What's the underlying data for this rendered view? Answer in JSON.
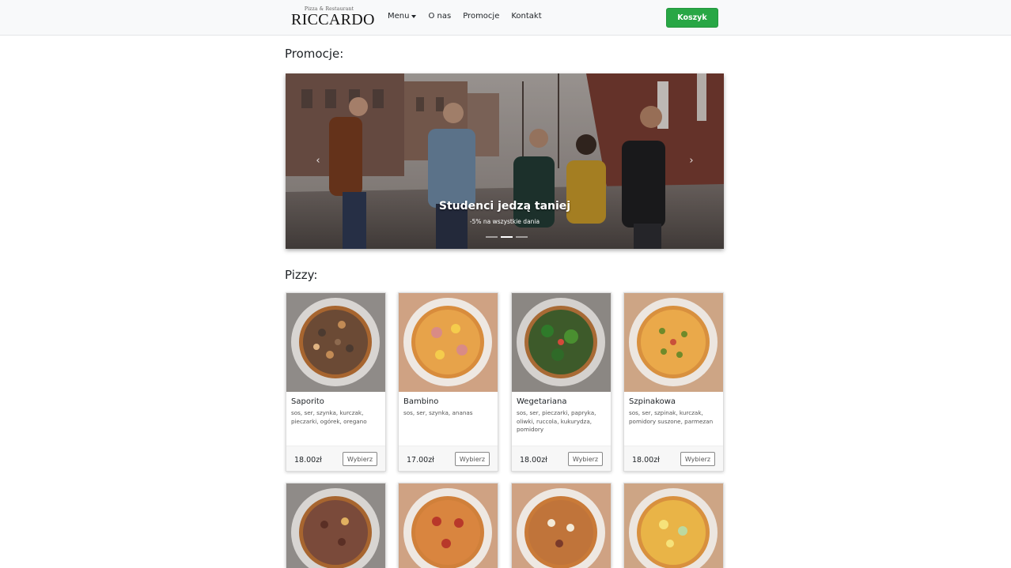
{
  "brand": {
    "small": "Pizza & Restaurant",
    "name": "RICCARDO"
  },
  "nav": {
    "items": [
      {
        "label": "Menu"
      },
      {
        "label": "O nas"
      },
      {
        "label": "Promocje"
      },
      {
        "label": "Kontakt"
      }
    ],
    "cart_label": "Koszyk"
  },
  "promotions": {
    "heading": "Promocje:",
    "slide_title": "Studenci jedzą taniej",
    "slide_subtitle": "-5% na wszystkie dania",
    "slides_count": 3,
    "active_slide": 2,
    "prev_icon": "chevron-left-icon",
    "next_icon": "chevron-right-icon"
  },
  "pizzas": {
    "heading": "Pizzy:",
    "choose_label": "Wybierz",
    "items": [
      {
        "name": "Saporito",
        "desc": "sos, ser, szynka, kurczak, pieczarki, ogórek, oregano",
        "price": "18.00zł"
      },
      {
        "name": "Bambino",
        "desc": "sos, ser, szynka, ananas",
        "price": "17.00zł"
      },
      {
        "name": "Wegetariana",
        "desc": "sos, ser, pieczarki, papryka, oliwki, ruccola, kukurydza, pomidory",
        "price": "18.00zł"
      },
      {
        "name": "Szpinakowa",
        "desc": "sos, ser, szpinak, kurczak, pomidory suszone, parmezan",
        "price": "18.00zł"
      }
    ]
  },
  "colors": {
    "accent": "#28a745",
    "navbar_bg": "#f8f9fa"
  }
}
